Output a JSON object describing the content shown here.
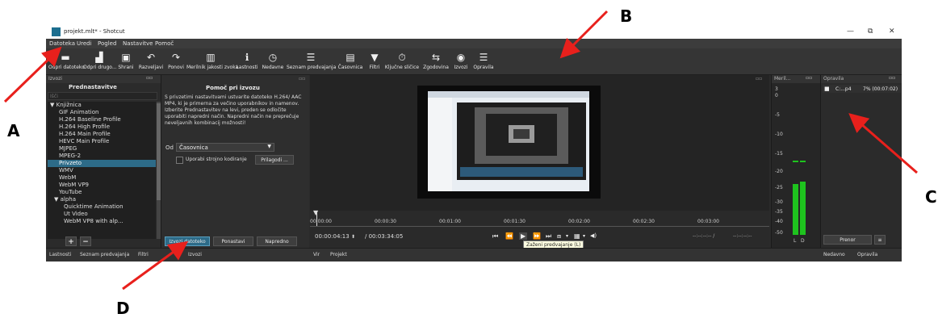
{
  "window": {
    "title": "projekt.mlt* - Shotcut",
    "min_glyph": "—",
    "max_glyph": "⧉",
    "close_glyph": "✕"
  },
  "menu": [
    "Datoteka",
    "Uredi",
    "Pogled",
    "Nastavitve",
    "Pomoč"
  ],
  "toolbar": [
    {
      "label": "Odpri datoteko",
      "icon": "folder-icon",
      "glyph": "▬"
    },
    {
      "label": "Odpri drugo...",
      "icon": "open-other-icon",
      "glyph": "▟"
    },
    {
      "label": "Shrani",
      "icon": "save-icon",
      "glyph": "▣"
    },
    {
      "label": "Razveljavi",
      "icon": "undo-icon",
      "glyph": "↶"
    },
    {
      "label": "Ponovi",
      "icon": "redo-icon",
      "glyph": "↷"
    },
    {
      "label": "Merilnik jakosti zvoka",
      "icon": "audio-meter-icon",
      "glyph": "▥"
    },
    {
      "label": "Lastnosti",
      "icon": "info-icon",
      "glyph": "ℹ"
    },
    {
      "label": "Nedavne",
      "icon": "clock-icon",
      "glyph": "◷"
    },
    {
      "label": "Seznam predvajanja",
      "icon": "list-icon",
      "glyph": "☰"
    },
    {
      "label": "Časovnica",
      "icon": "timeline-icon",
      "glyph": "▤"
    },
    {
      "label": "Filtri",
      "icon": "filter-icon",
      "glyph": "▼"
    },
    {
      "label": "Ključne sličice",
      "icon": "stopwatch-icon",
      "glyph": "⏱"
    },
    {
      "label": "Zgodovina",
      "icon": "history-icon",
      "glyph": "⇆"
    },
    {
      "label": "Izvozi",
      "icon": "export-icon",
      "glyph": "◉"
    },
    {
      "label": "Opravila",
      "icon": "jobs-icon",
      "glyph": "☰"
    }
  ],
  "export_panel": {
    "header": "Izvozi",
    "presets_title": "Prednastavitve",
    "search_placeholder": "Išči",
    "presets": [
      {
        "label": "Knjižnica",
        "type": "group",
        "arrow": "▼"
      },
      {
        "label": "GIF Animation"
      },
      {
        "label": "H.264 Baseline Profile"
      },
      {
        "label": "H.264 High Profile"
      },
      {
        "label": "H.264 Main Profile"
      },
      {
        "label": "HEVC Main Profile"
      },
      {
        "label": "MJPEG"
      },
      {
        "label": "MPEG-2"
      },
      {
        "label": "Privzeto",
        "selected": true
      },
      {
        "label": "WMV"
      },
      {
        "label": "WebM"
      },
      {
        "label": "WebM VP9"
      },
      {
        "label": "YouTube"
      },
      {
        "label": "alpha",
        "type": "group",
        "arrow": "▼"
      },
      {
        "label": "Quicktime Animation"
      },
      {
        "label": "Ut Video"
      },
      {
        "label": "WebM VP8 with alp..."
      }
    ],
    "add_glyph": "+",
    "remove_glyph": "−",
    "help_title": "Pomoč pri izvozu",
    "help_text": "S privzetimi nastavitvami ustvarite datoteko H.264/ AAC MP4, ki je primerna za večino uporabnikov in namenov. Izberite Prednastavitev na levi, preden se odločite uporabiti napredni način. Napredni način ne preprečuje neveljavnih kombinacij možnosti!",
    "from_label": "Od",
    "from_value": "Časovnica",
    "hw_encoding_label": "Uporabi strojno kodiranje",
    "customize_label": "Prilagodi ...",
    "export_file_btn": "Izvozi datoteko",
    "reset_btn": "Ponastavi",
    "advanced_btn": "Napredno"
  },
  "timeline": {
    "ticks": [
      "00:00:00",
      "00:00:30",
      "00:01:00",
      "00:01:30",
      "00:02:00",
      "00:02:30",
      "00:03:00"
    ],
    "current_time": "00:00:04:13",
    "total_time": "/ 00:03:34:05",
    "in_out_left": "--:--:--:-- /",
    "in_out_right": "--:--:--:--",
    "tooltip": "Zaženi predvajanje (L)",
    "controls": [
      "⏮",
      "⏪",
      "▶",
      "⏩",
      "⏭",
      "⧈",
      "▾",
      "▦",
      "▾",
      "◀)"
    ]
  },
  "meter": {
    "header": "Meril...",
    "scale": [
      "3",
      "0",
      "-5",
      "-10",
      "-15",
      "-20",
      "-25",
      "-30",
      "-35",
      "-40",
      "-50"
    ],
    "channels": [
      "L",
      "D"
    ],
    "level_l": 0.37,
    "level_r": 0.39
  },
  "jobs": {
    "header": "Opravila",
    "job_name": "C:...p4",
    "job_status": "7% (00:07:02)",
    "pause_btn": "Prenor",
    "menu_glyph": "≡"
  },
  "bottom_tabs_left": [
    "Lastnosti",
    "Seznam predvajanja",
    "Filtri",
    "Izvozi"
  ],
  "bottom_tabs_mid": [
    "Vir",
    "Projekt"
  ],
  "bottom_tabs_right": [
    "Nedavno",
    "Opravila"
  ],
  "annotations": [
    "A",
    "B",
    "C",
    "D"
  ],
  "colors": {
    "accent": "#2d6b88",
    "arrow": "#e8201c",
    "meter_green": "#1ec31e"
  }
}
